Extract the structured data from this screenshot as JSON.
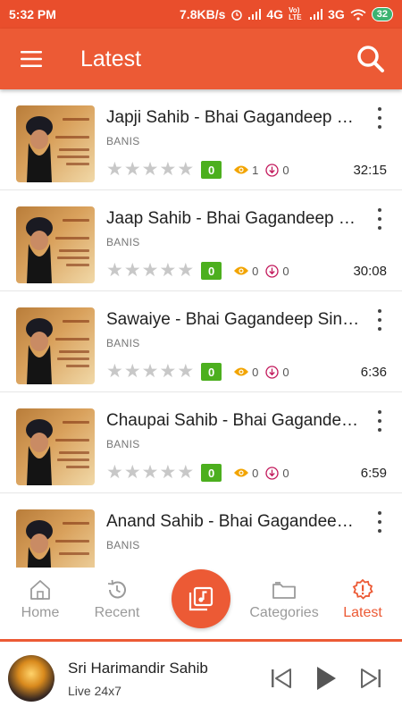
{
  "status": {
    "time": "5:32 PM",
    "speed": "7.8KB/s",
    "net1": "4G",
    "net2": "Vo) LTE",
    "net3": "3G",
    "battery": "32"
  },
  "appbar": {
    "title": "Latest"
  },
  "list": {
    "items": [
      {
        "title": "Japji Sahib - Bhai Gagandeep Singh",
        "category": "BANIS",
        "rating": "0",
        "views": "1",
        "downloads": "0",
        "duration": "32:15"
      },
      {
        "title": "Jaap Sahib - Bhai Gagandeep Singh",
        "category": "BANIS",
        "rating": "0",
        "views": "0",
        "downloads": "0",
        "duration": "30:08"
      },
      {
        "title": "Sawaiye - Bhai Gagandeep Singh",
        "category": "BANIS",
        "rating": "0",
        "views": "0",
        "downloads": "0",
        "duration": "6:36"
      },
      {
        "title": "Chaupai Sahib - Bhai Gagandeep Singh",
        "category": "BANIS",
        "rating": "0",
        "views": "0",
        "downloads": "0",
        "duration": "6:59"
      },
      {
        "title": "Anand Sahib - Bhai Gagandeep Singh",
        "category": "BANIS"
      }
    ]
  },
  "nav": {
    "home": "Home",
    "recent": "Recent",
    "categories": "Categories",
    "latest": "Latest"
  },
  "player": {
    "title": "Sri Harimandir Sahib",
    "subtitle": "Live 24x7"
  },
  "colors": {
    "accent": "#ec5a35",
    "rating_badge": "#4caf1e",
    "views_icon": "#f2a400",
    "downloads_icon": "#c2185b"
  }
}
